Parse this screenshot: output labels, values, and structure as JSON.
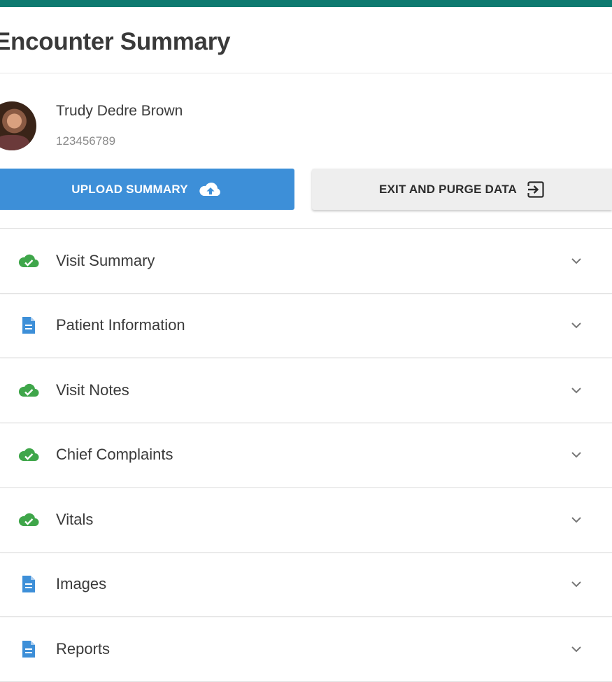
{
  "header": {
    "title": "Encounter Summary"
  },
  "patient": {
    "name": "Trudy Dedre Brown",
    "id": "123456789"
  },
  "actions": {
    "upload_label": "UPLOAD SUMMARY",
    "upload_icon": "cloud-upload-icon",
    "exit_label": "EXIT AND PURGE DATA",
    "exit_icon": "exit-to-app-icon"
  },
  "sections": [
    {
      "label": "Visit Summary",
      "status_icon": "cloud-check-icon"
    },
    {
      "label": "Patient Information",
      "status_icon": "document-icon"
    },
    {
      "label": "Visit Notes",
      "status_icon": "cloud-check-icon"
    },
    {
      "label": "Chief Complaints",
      "status_icon": "cloud-check-icon"
    },
    {
      "label": "Vitals",
      "status_icon": "cloud-check-icon"
    },
    {
      "label": "Images",
      "status_icon": "document-icon"
    },
    {
      "label": "Reports",
      "status_icon": "document-icon"
    }
  ],
  "colors": {
    "topbar": "#0e7a70",
    "primary_button": "#3d8fd8",
    "secondary_button": "#eeeeee",
    "status_complete": "#3fa64a",
    "status_document": "#3d8fd8"
  }
}
